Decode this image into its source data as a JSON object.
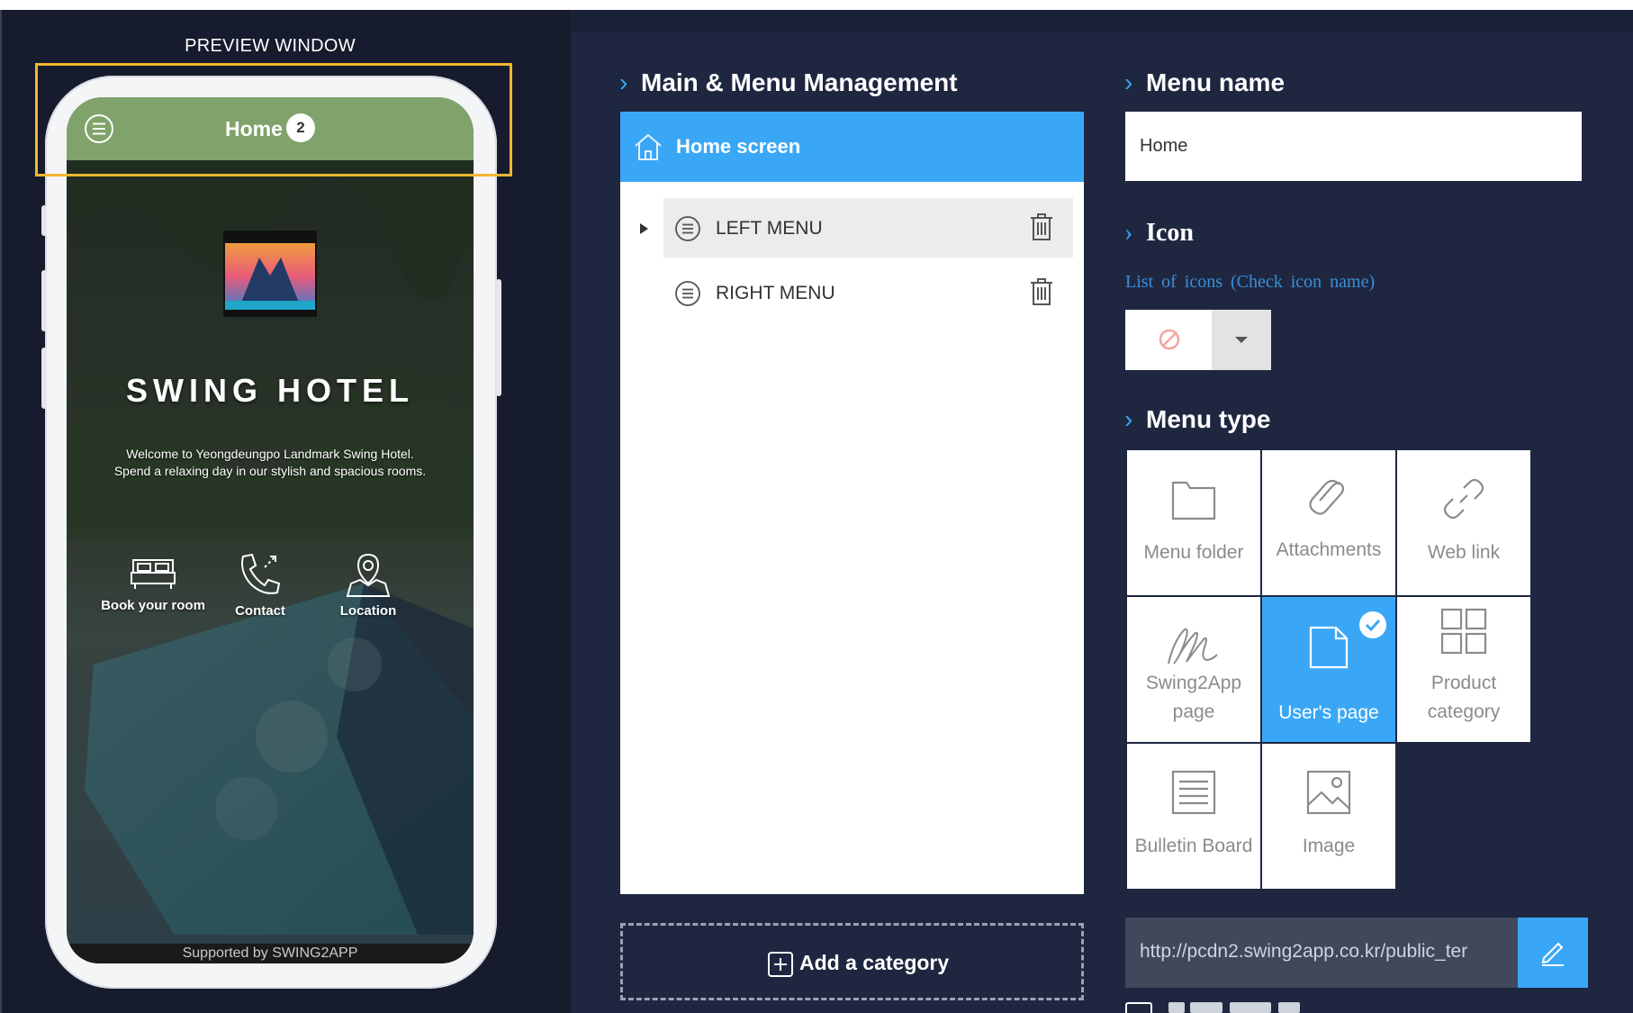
{
  "preview": {
    "label": "PREVIEW WINDOW",
    "header_title": "Home",
    "header_badge": "2",
    "hotel_title": "SWING HOTEL",
    "welcome_line1": "Welcome to Yeongdeungpo Landmark Swing Hotel.",
    "welcome_line2": "Spend a relaxing day in our stylish and spacious rooms.",
    "quick_actions": [
      {
        "label": "Book your room",
        "icon": "bed-icon"
      },
      {
        "label": "Contact",
        "icon": "phone-icon"
      },
      {
        "label": "Location",
        "icon": "location-pin-icon"
      }
    ],
    "footer": "Supported by SWING2APP",
    "header_color": "#7fa36a",
    "highlight_color": "#f5b731"
  },
  "management": {
    "title": "Main & Menu Management",
    "home_screen": "Home screen",
    "items": [
      {
        "label": "LEFT MENU",
        "selected": true
      },
      {
        "label": "RIGHT MENU",
        "selected": false
      }
    ],
    "add_category": "Add a category",
    "accent_color": "#3aa7f6"
  },
  "menu_name": {
    "title": "Menu name",
    "value": "Home"
  },
  "icon": {
    "title": "Icon",
    "link_text": "List of icons (Check icon name)",
    "selected_icon": "no-icon"
  },
  "menu_type": {
    "title": "Menu type",
    "options": [
      {
        "label": "Menu folder",
        "icon": "folder-icon",
        "selected": false
      },
      {
        "label": "Attachments",
        "icon": "paperclip-icon",
        "selected": false
      },
      {
        "label": "Web link",
        "icon": "link-icon",
        "selected": false
      },
      {
        "label": "Swing2App page",
        "icon": "signature-icon",
        "selected": false
      },
      {
        "label": "User's page",
        "icon": "page-icon",
        "selected": true
      },
      {
        "label": "Product category",
        "icon": "grid-icon",
        "selected": false
      },
      {
        "label": "Bulletin Board",
        "icon": "list-document-icon",
        "selected": false
      },
      {
        "label": "Image",
        "icon": "image-icon",
        "selected": false
      }
    ]
  },
  "url": {
    "value": "http://pcdn2.swing2app.co.kr/public_ter"
  }
}
